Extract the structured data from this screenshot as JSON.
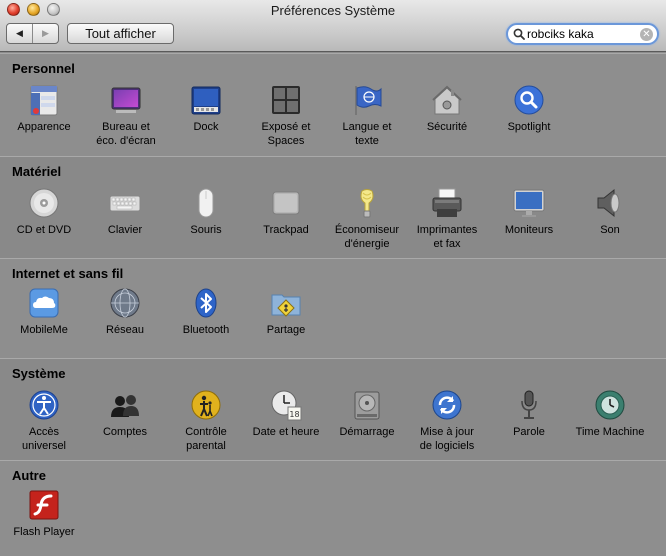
{
  "window": {
    "title": "Préférences Système"
  },
  "toolbar": {
    "back": "◀",
    "forward": "▶",
    "show_all": "Tout afficher",
    "search_value": "robciks kaka",
    "clear": "✕"
  },
  "sections": [
    {
      "title": "Personnel",
      "items": [
        {
          "label": "Apparence",
          "icon": "apparence-icon"
        },
        {
          "label": "Bureau et\néco. d'écran",
          "icon": "desktop-icon"
        },
        {
          "label": "Dock",
          "icon": "dock-icon"
        },
        {
          "label": "Exposé et\nSpaces",
          "icon": "expose-icon"
        },
        {
          "label": "Langue et\ntexte",
          "icon": "language-flag-icon"
        },
        {
          "label": "Sécurité",
          "icon": "security-house-icon"
        },
        {
          "label": "Spotlight",
          "icon": "spotlight-icon"
        }
      ]
    },
    {
      "title": "Matériel",
      "items": [
        {
          "label": "CD et DVD",
          "icon": "cd-icon"
        },
        {
          "label": "Clavier",
          "icon": "keyboard-icon"
        },
        {
          "label": "Souris",
          "icon": "mouse-icon"
        },
        {
          "label": "Trackpad",
          "icon": "trackpad-icon"
        },
        {
          "label": "Économiseur\nd'énergie",
          "icon": "bulb-icon"
        },
        {
          "label": "Imprimantes\net fax",
          "icon": "printer-icon"
        },
        {
          "label": "Moniteurs",
          "icon": "monitor-icon"
        },
        {
          "label": "Son",
          "icon": "speaker-icon"
        }
      ]
    },
    {
      "title": "Internet et sans fil",
      "items": [
        {
          "label": "MobileMe",
          "icon": "cloud-icon"
        },
        {
          "label": "Réseau",
          "icon": "network-globe-icon"
        },
        {
          "label": "Bluetooth",
          "icon": "bluetooth-icon"
        },
        {
          "label": "Partage",
          "icon": "sharing-folder-icon"
        }
      ]
    },
    {
      "title": "Système",
      "items": [
        {
          "label": "Accès\nuniversel",
          "icon": "accessibility-icon"
        },
        {
          "label": "Comptes",
          "icon": "accounts-icon"
        },
        {
          "label": "Contrôle\nparental",
          "icon": "parental-controls-icon"
        },
        {
          "label": "Date et heure",
          "icon": "clock-icon"
        },
        {
          "label": "Démarrage",
          "icon": "startup-disk-icon"
        },
        {
          "label": "Mise à jour\nde logiciels",
          "icon": "software-update-icon"
        },
        {
          "label": "Parole",
          "icon": "microphone-icon"
        },
        {
          "label": "Time Machine",
          "icon": "time-machine-icon"
        }
      ]
    },
    {
      "title": "Autre",
      "items": [
        {
          "label": "Flash Player",
          "icon": "flash-player-icon"
        }
      ]
    }
  ]
}
